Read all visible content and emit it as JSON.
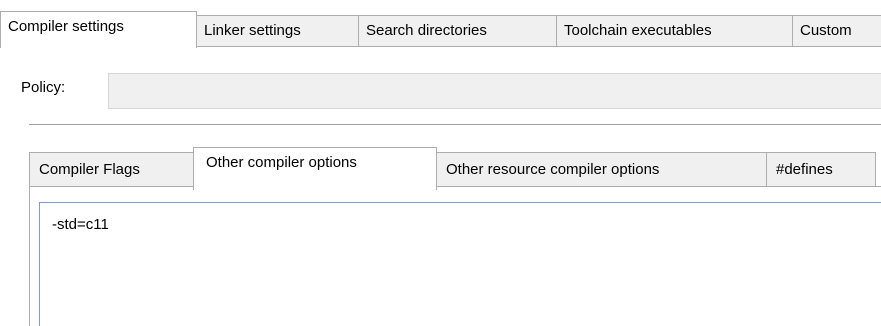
{
  "top_tabs": [
    {
      "label": "Compiler settings",
      "active": true
    },
    {
      "label": "Linker settings",
      "active": false
    },
    {
      "label": "Search directories",
      "active": false
    },
    {
      "label": "Toolchain executables",
      "active": false
    },
    {
      "label": "Custom",
      "active": false
    }
  ],
  "policy": {
    "label": "Policy:",
    "value": ""
  },
  "inner_tabs": [
    {
      "label": "Compiler Flags",
      "active": false
    },
    {
      "label": "Other compiler options",
      "active": true
    },
    {
      "label": "Other resource compiler options",
      "active": false
    },
    {
      "label": "#defines",
      "active": false
    }
  ],
  "other_options": {
    "text": "-std=c11"
  },
  "colors": {
    "tab_inactive_bg": "#f0f0f0",
    "tab_active_bg": "#ffffff",
    "tab_border": "#adadad",
    "focus_border": "#7a9cd3"
  }
}
